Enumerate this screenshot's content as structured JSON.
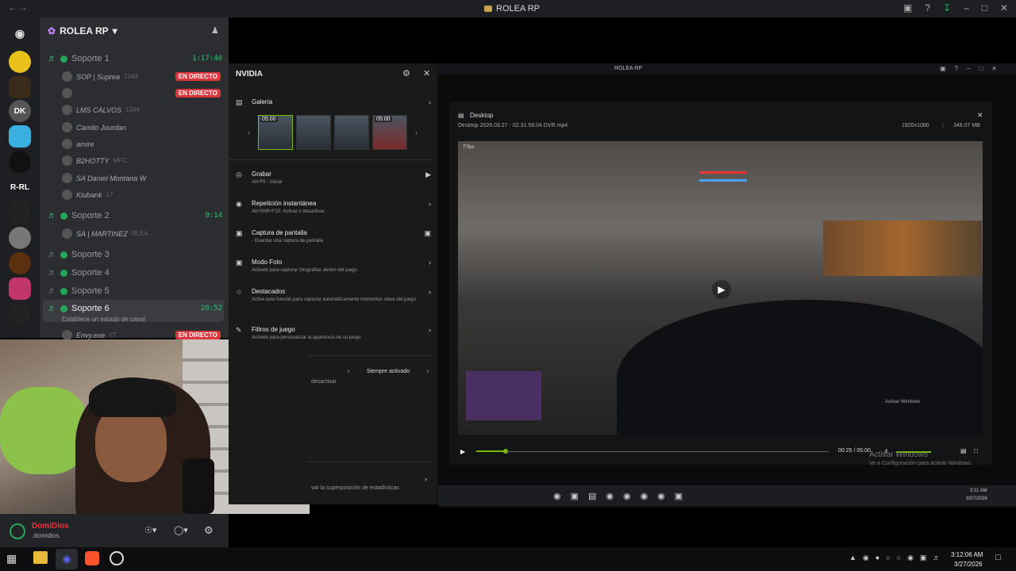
{
  "titlebar": {
    "title": "ROLEA RP"
  },
  "server": {
    "name": "ROLEA RP",
    "rail_labels": [
      "DK",
      "R-RL"
    ]
  },
  "channels": [
    {
      "name": "Soporte 1",
      "time": "1:17:40",
      "active": true
    },
    {
      "name": "Soporte 2",
      "time": "9:14",
      "active": true
    },
    {
      "name": "Soporte 3"
    },
    {
      "name": "Soporte 4"
    },
    {
      "name": "Soporte 5"
    },
    {
      "name": "Soporte 6",
      "time": "20:52",
      "active": true,
      "status": "Establece un estado de canal"
    }
  ],
  "users": [
    {
      "name": "SOP | Suprea",
      "extra": "1344",
      "live": "EN DIRECTO"
    },
    {
      "name": "",
      "live": "EN DIRECTO"
    },
    {
      "name": "LMS CALVOS",
      "extra": "1344"
    },
    {
      "name": "Camilo Jourdan"
    },
    {
      "name": "amire"
    },
    {
      "name": "B2HOTTY",
      "extra": "MFC"
    },
    {
      "name": "SA Daniel Montana W"
    },
    {
      "name": "Kiubank",
      "extra": "17"
    },
    {
      "name": "SA | MARTINEZ",
      "extra": "RLEA"
    },
    {
      "name": "Envy.exe",
      "extra": "nT",
      "live": "EN DIRECTO"
    }
  ],
  "userbar": {
    "display": "DomiDios",
    "handle": ".domidios."
  },
  "nvidia": {
    "title": "NVIDIA",
    "gallery": "Galería",
    "thumbs": [
      "05:00",
      "",
      "",
      "05:00"
    ],
    "items": [
      {
        "t": "Grabar",
        "s": "Alt+F9 - Iniciar"
      },
      {
        "t": "Repetición instantánea",
        "s": "Alt+Shift+F10: Activar o desactivar"
      },
      {
        "t": "Captura de pantalla",
        "s": "- Guardar una captura de pantalla"
      },
      {
        "t": "Modo Foto",
        "s": "Activelo para capturar fotografias dentro del juego"
      },
      {
        "t": "Destacados",
        "s": "Active esta función para capturar automáticamente momentos clave del juego"
      },
      {
        "t": "Filtros de juego",
        "s": "Activelo para personalizar la apariencia de su juego"
      }
    ],
    "always": "Siempre activado",
    "deactivate": "desactivar",
    "overlay": "var la superposición de estadísticas"
  },
  "rightwin": {
    "title": "ROLEA RP"
  },
  "player": {
    "title": "Desktop",
    "file": "Desktop 2026.03.27 - 02.31.59.04.DVR.mp4",
    "res": "1920x1080",
    "size": "346.07 MB",
    "time": "00:25 / 05:00",
    "progress": 0.08,
    "fps": "77fps",
    "watermark1": "Activar Windows",
    "watermark2": "Ve a Configuración para activar Windows."
  },
  "inner_taskbar": {
    "time": "3:11 AM",
    "date": "3/27/2026"
  },
  "taskbar": {
    "time": "3:12:06 AM",
    "date": "3/27/2026"
  }
}
